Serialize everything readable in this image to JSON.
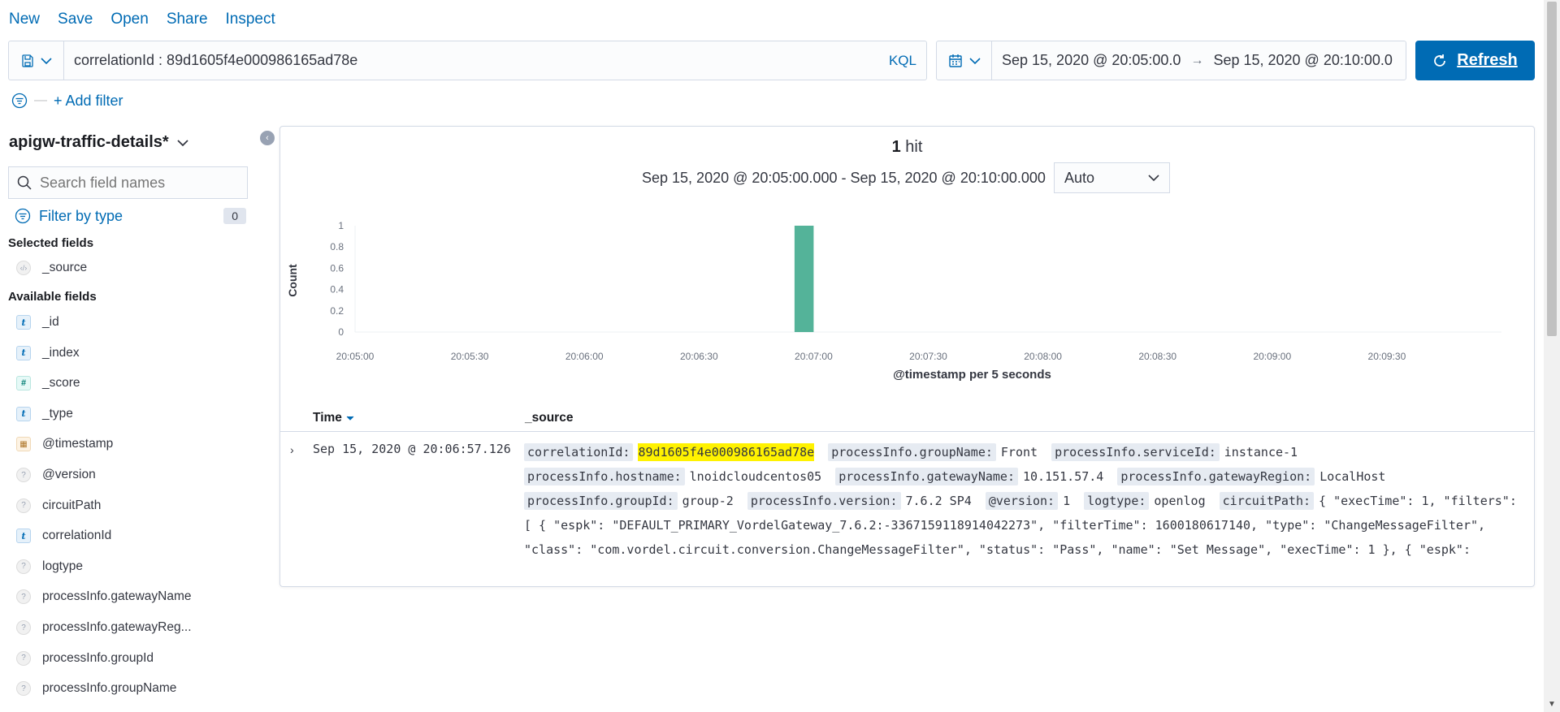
{
  "topnav": {
    "new": "New",
    "save": "Save",
    "open": "Open",
    "share": "Share",
    "inspect": "Inspect"
  },
  "query": {
    "value": "correlationId : 89d1605f4e000986165ad78e",
    "language": "KQL"
  },
  "time": {
    "start": "Sep 15, 2020 @ 20:05:00.0",
    "end": "Sep 15, 2020 @ 20:10:00.0"
  },
  "refresh_label": "Refresh",
  "add_filter_label": "+ Add filter",
  "sidebar": {
    "index_pattern": "apigw-traffic-details*",
    "search_placeholder": "Search field names",
    "filter_by_type": "Filter by type",
    "filter_count": "0",
    "selected_title": "Selected fields",
    "available_title": "Available fields",
    "selected_fields": [
      {
        "name": "_source",
        "type": "source"
      }
    ],
    "available_fields": [
      {
        "name": "_id",
        "type": "string"
      },
      {
        "name": "_index",
        "type": "string"
      },
      {
        "name": "_score",
        "type": "number"
      },
      {
        "name": "_type",
        "type": "string"
      },
      {
        "name": "@timestamp",
        "type": "date"
      },
      {
        "name": "@version",
        "type": "unknown"
      },
      {
        "name": "circuitPath",
        "type": "unknown"
      },
      {
        "name": "correlationId",
        "type": "string"
      },
      {
        "name": "logtype",
        "type": "unknown"
      },
      {
        "name": "processInfo.gatewayName",
        "type": "unknown"
      },
      {
        "name": "processInfo.gatewayReg...",
        "type": "unknown"
      },
      {
        "name": "processInfo.groupId",
        "type": "unknown"
      },
      {
        "name": "processInfo.groupName",
        "type": "unknown"
      }
    ]
  },
  "main": {
    "hits_count": "1",
    "hits_label": "hit",
    "range_text": "Sep 15, 2020 @ 20:05:00.000 - Sep 15, 2020 @ 20:10:00.000",
    "interval": "Auto",
    "table": {
      "col_time": "Time",
      "col_source": "_source",
      "row_time": "Sep 15, 2020 @ 20:06:57.126",
      "source_pairs": [
        {
          "k": "correlationId:",
          "v": "89d1605f4e000986165ad78e",
          "hl": true
        },
        {
          "k": "processInfo.groupName:",
          "v": "Front"
        },
        {
          "k": "processInfo.serviceId:",
          "v": "instance-1"
        },
        {
          "k": "processInfo.hostname:",
          "v": "lnoidcloudcentos05"
        },
        {
          "k": "processInfo.gatewayName:",
          "v": "10.151.57.4"
        },
        {
          "k": "processInfo.gatewayRegion:",
          "v": "LocalHost"
        },
        {
          "k": "processInfo.groupId:",
          "v": "group-2"
        },
        {
          "k": "processInfo.version:",
          "v": "7.6.2 SP4"
        },
        {
          "k": "@version:",
          "v": "1"
        },
        {
          "k": "logtype:",
          "v": "openlog"
        },
        {
          "k": "circuitPath:",
          "v": "{ \"execTime\": 1, \"filters\": [ { \"espk\": \"DEFAULT_PRIMARY_VordelGateway_7.6.2:-3367159118914042273\", \"filterTime\": 1600180617140, \"type\": \"ChangeMessageFilter\", \"class\": \"com.vordel.circuit.conversion.ChangeMessageFilter\", \"status\": \"Pass\", \"name\": \"Set Message\", \"execTime\": 1 }, { \"espk\":"
        }
      ]
    }
  },
  "chart_data": {
    "type": "bar",
    "title": "",
    "xlabel": "@timestamp per 5 seconds",
    "ylabel": "Count",
    "x_ticks": [
      "20:05:00",
      "20:05:30",
      "20:06:00",
      "20:06:30",
      "20:07:00",
      "20:07:30",
      "20:08:00",
      "20:08:30",
      "20:09:00",
      "20:09:30"
    ],
    "y_ticks": [
      "0",
      "0.2",
      "0.4",
      "0.6",
      "0.6",
      "0.8",
      "1"
    ],
    "y_tick_values": [
      0,
      0.2,
      0.4,
      0.6,
      0.8,
      1
    ],
    "ylim": [
      0,
      1
    ],
    "x_range_seconds": [
      0,
      300
    ],
    "bars": [
      {
        "bucket_start": "20:06:55",
        "bucket_seconds": 115,
        "width_seconds": 5,
        "value": 1
      }
    ],
    "bar_color": "#54b399"
  }
}
